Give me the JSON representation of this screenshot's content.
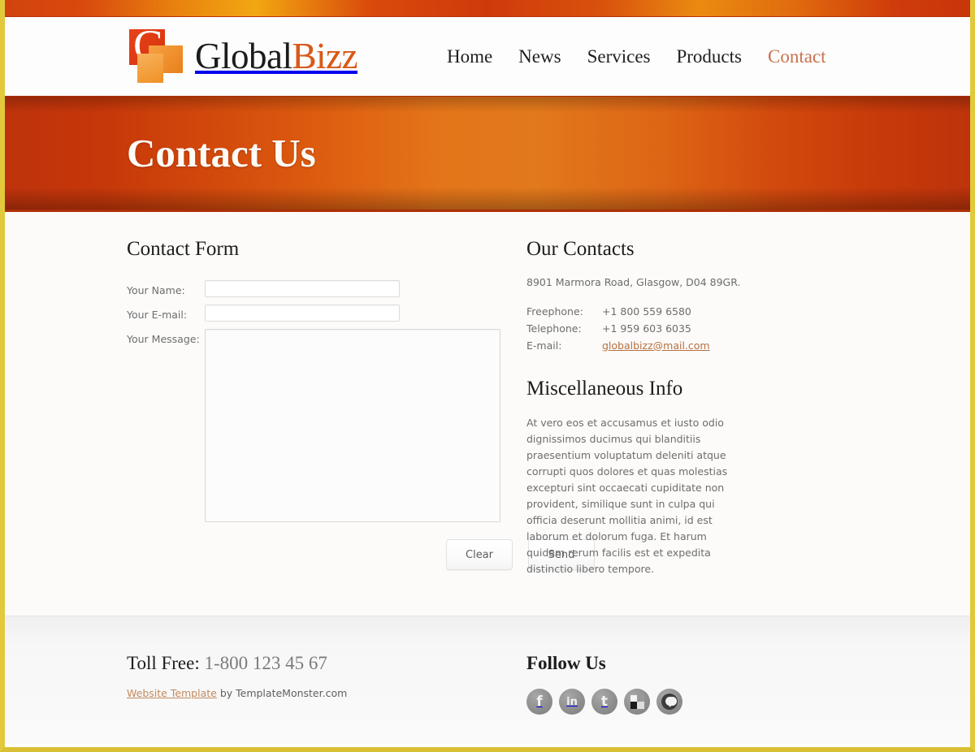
{
  "theme": {
    "frame_color": "#e2c93c",
    "banner_orange": "#e2791c",
    "banner_red": "#bf330c",
    "accent_link": "#b5703f",
    "nav_active": "#c9714e"
  },
  "header": {
    "logo": {
      "mark_letter": "G",
      "name_first": "Global",
      "name_second": "Bizz"
    },
    "nav": [
      {
        "label": "Home",
        "active": false
      },
      {
        "label": "News",
        "active": false
      },
      {
        "label": "Services",
        "active": false
      },
      {
        "label": "Products",
        "active": false
      },
      {
        "label": "Contact",
        "active": true
      }
    ]
  },
  "banner": {
    "title": "Contact Us"
  },
  "contact_form": {
    "heading": "Contact Form",
    "fields": [
      {
        "label": "Your Name:",
        "value": "",
        "placeholder": ""
      },
      {
        "label": "Your E-mail:",
        "value": "",
        "placeholder": ""
      },
      {
        "label": "Your Message:",
        "value": "",
        "placeholder": ""
      }
    ],
    "buttons": {
      "clear": "Clear",
      "send": "Send"
    }
  },
  "our_contacts": {
    "heading": "Our Contacts",
    "address": "8901 Marmora Road, Glasgow, D04 89GR.",
    "rows": [
      {
        "label": "Freephone:",
        "value": "+1 800 559 6580",
        "is_link": false
      },
      {
        "label": "Telephone:",
        "value": "+1 959 603 6035",
        "is_link": false
      },
      {
        "label": "E-mail:",
        "value": "globalbizz@mail.com",
        "is_link": true
      }
    ]
  },
  "misc_info": {
    "heading": "Miscellaneous Info",
    "paragraph": "At vero eos et accusamus et iusto odio dignissimos ducimus qui blanditiis praesentium voluptatum deleniti atque corrupti quos dolores et quas molestias excepturi sint occaecati cupiditate non provident, similique sunt in culpa qui officia deserunt mollitia animi, id est laborum et dolorum fuga. Et harum quidem rerum facilis est et expedita distinctio libero tempore."
  },
  "footer": {
    "toll_free_label": "Toll Free:",
    "toll_free_number": "1-800 123 45 67",
    "credit_link": "Website Template",
    "credit_rest": " by TemplateMonster.com",
    "follow_title": "Follow Us",
    "social": [
      {
        "name": "facebook-icon",
        "glyph": "f"
      },
      {
        "name": "linkedin-icon",
        "glyph": "in"
      },
      {
        "name": "twitter-icon",
        "glyph": "t"
      },
      {
        "name": "delicious-icon",
        "glyph": ""
      },
      {
        "name": "technorati-icon",
        "glyph": ""
      }
    ]
  }
}
